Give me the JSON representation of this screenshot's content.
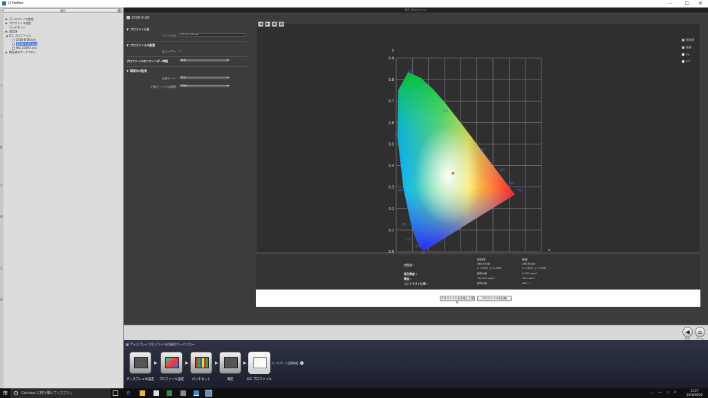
{
  "window": {
    "title": "i1Profiler",
    "controls": [
      "—",
      "☐",
      "✕"
    ]
  },
  "left_panel": {
    "header": "項目",
    "strip_marks": [
      "ン",
      "ト",
      "M",
      "セ",
      "W",
      "ス",
      "W"
    ],
    "tree": [
      {
        "label": "ディスプレイの設定",
        "level": 0,
        "toggle": "▶"
      },
      {
        "label": "プロファイル設定",
        "level": 0,
        "toggle": "▶"
      },
      {
        "label": "パッチセット",
        "level": 0,
        "toggle": ""
      },
      {
        "label": "測定値",
        "level": 0,
        "toggle": "▶"
      },
      {
        "label": "ICC プロファイル",
        "level": 0,
        "toggle": "◢"
      },
      {
        "label": "2016-8-28.icm",
        "level": 1,
        "doc": true
      },
      {
        "label": "2016-9-29.icm",
        "level": 1,
        "doc": true,
        "selected": true
      },
      {
        "label": "PHL 272P4.icm",
        "level": 1,
        "doc": true
      },
      {
        "label": "保存済みワークフロー",
        "level": 0,
        "toggle": "▶"
      }
    ]
  },
  "main": {
    "header": "ICC プロファイル",
    "profile_name": "2016-9-29",
    "sections": {
      "profile_name": {
        "title": "プロファイル名",
        "file_label": "ファイル名 :",
        "file_value": "2016-9-29.icm"
      },
      "profile_placement": {
        "title": "プロファイルの配置",
        "all_users_label": "全ユーザー :",
        "all_users_check": "✓",
        "reminder_label": "プロファイルのリマインダー時期",
        "reminder_value": "毎月"
      },
      "monitoring": {
        "title": "環境光の監視",
        "mode_label": "監視モード :",
        "mode_value": "なし",
        "interval_label": "評価チェックの間隔 :",
        "interval_value": "60分"
      }
    }
  },
  "chart_tabs": [
    "◀",
    "▶",
    "▣",
    "▦"
  ],
  "chart_legend": [
    {
      "label": "参照値",
      "kind": "swatch"
    },
    {
      "label": "結果",
      "kind": "swatch"
    },
    {
      "label": "xy",
      "kind": "radio"
    },
    {
      "label": "u'v'",
      "kind": "radio"
    }
  ],
  "chart_data": {
    "type": "scatter",
    "xlabel": "x",
    "ylabel": "y",
    "xlim": [
      0,
      0.9
    ],
    "ylim": [
      0,
      0.9
    ],
    "x_ticks": [
      "0.0",
      "0.1",
      "0.2",
      "0.3",
      "0.4",
      "0.5",
      "0.6",
      "0.7",
      "0.8",
      "0.9"
    ],
    "y_ticks": [
      "0.0",
      "0.1",
      "0.2",
      "0.3",
      "0.4",
      "0.5",
      "0.6",
      "0.7",
      "0.8",
      "0.9"
    ],
    "grid": true,
    "white_point": {
      "x": 0.352,
      "y": 0.364,
      "color": "#e05a3a"
    },
    "spectral_locus": [
      [
        0.1741,
        0.005
      ],
      [
        0.1738,
        0.0049
      ],
      [
        0.173,
        0.0048
      ],
      [
        0.1714,
        0.0051
      ],
      [
        0.1689,
        0.0069
      ],
      [
        0.1644,
        0.0109
      ],
      [
        0.1566,
        0.0177
      ],
      [
        0.144,
        0.0297
      ],
      [
        0.1241,
        0.0578
      ],
      [
        0.0913,
        0.1327
      ],
      [
        0.0454,
        0.295
      ],
      [
        0.0082,
        0.5384
      ],
      [
        0.0139,
        0.7502
      ],
      [
        0.0743,
        0.8338
      ],
      [
        0.1547,
        0.8059
      ],
      [
        0.2296,
        0.7543
      ],
      [
        0.3016,
        0.6923
      ],
      [
        0.3731,
        0.6245
      ],
      [
        0.4441,
        0.5547
      ],
      [
        0.5125,
        0.4866
      ],
      [
        0.5752,
        0.4242
      ],
      [
        0.627,
        0.3725
      ],
      [
        0.6658,
        0.334
      ],
      [
        0.6915,
        0.3083
      ],
      [
        0.7079,
        0.292
      ],
      [
        0.719,
        0.2809
      ],
      [
        0.726,
        0.274
      ],
      [
        0.7347,
        0.2653
      ]
    ],
    "wavelength_labels": [
      {
        "text": "520",
        "x": 0.074,
        "y": 0.834
      },
      {
        "text": "540",
        "x": 0.16,
        "y": 0.78
      },
      {
        "text": "560",
        "x": 0.29,
        "y": 0.65
      },
      {
        "text": "580",
        "x": 0.52,
        "y": 0.47
      },
      {
        "text": "600",
        "x": 0.64,
        "y": 0.375
      },
      {
        "text": "620",
        "x": 0.7,
        "y": 0.315
      },
      {
        "text": "700",
        "x": 0.75,
        "y": 0.28
      },
      {
        "text": "500",
        "x": -0.01,
        "y": 0.54
      },
      {
        "text": "490",
        "x": 0.01,
        "y": 0.28
      },
      {
        "text": "480",
        "x": 0.03,
        "y": 0.12
      },
      {
        "text": "470",
        "x": 0.06,
        "y": 0.05
      },
      {
        "text": "460",
        "x": 0.12,
        "y": 0.02
      },
      {
        "text": "380",
        "x": 0.15,
        "y": -0.01
      }
    ]
  },
  "results": {
    "col_reference": "参照値",
    "col_result": "結果",
    "rows": [
      {
        "label": "白色点 :",
        "ref": [
          "D65 6504K",
          "x: 0.3127, y: 0.3290"
        ],
        "res": [
          "D65 6504K",
          "x: 0.3127, y: 0.3290"
        ]
      },
      {
        "label": "黒色輝度 :",
        "ref": [
          "固有の値"
        ],
        "res": [
          "0.237 cd/m²"
        ]
      },
      {
        "label": "輝度 :",
        "ref": [
          "120.000 cd/m²"
        ],
        "res": [
          "120 cd/m²"
        ]
      },
      {
        "label": "コントラスト比率 :",
        "ref": [
          "固有の値"
        ],
        "res": [
          "494 : 1"
        ]
      }
    ]
  },
  "buttons": {
    "save": "プロファイルを作成して保存",
    "compare": "プロファイルを比較"
  },
  "nav": {
    "back_label": "戻る",
    "home_label": "ホーム"
  },
  "workflow": {
    "title": "ディスプレイプロファイル作成のワークフロー",
    "steps": [
      {
        "label": "ディスプレイの設定"
      },
      {
        "label": "プロファイル設定"
      },
      {
        "label": "パッチセット"
      },
      {
        "label": "測定"
      },
      {
        "label": "ICC プロファイル"
      }
    ],
    "extra": "ディスプレイ品質検証"
  },
  "taskbar": {
    "search_placeholder": "Cortana に何か聞いてください。",
    "time": "23:57",
    "date": "2016/09/29"
  }
}
